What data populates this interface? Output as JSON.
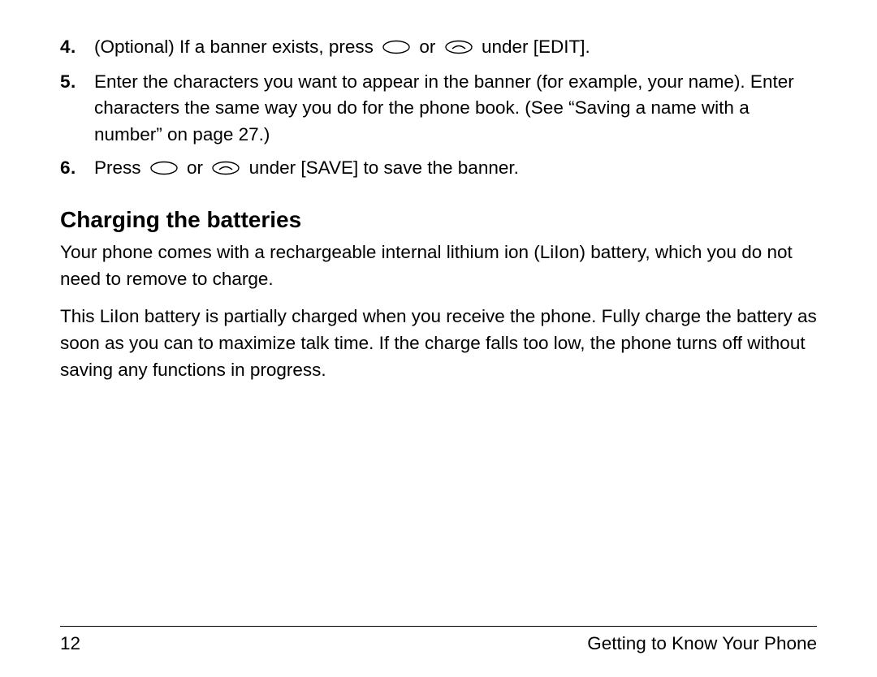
{
  "items": [
    {
      "num": "4.",
      "parts": {
        "a": "(Optional) If a banner exists, press ",
        "or": " or ",
        "b": " under [EDIT]."
      }
    },
    {
      "num": "5.",
      "text": "Enter the characters you want to appear in the banner (for example, your name). Enter characters the same way you do for the phone book. (See “Saving a name with a number” on page 27.)"
    },
    {
      "num": "6.",
      "parts": {
        "a": "Press ",
        "or": " or ",
        "b": " under [SAVE] to save the banner."
      }
    }
  ],
  "heading": "Charging the batteries",
  "p1": "Your phone comes with a rechargeable internal lithium ion (LiIon) battery, which you do not need to remove to charge.",
  "p2": "This LiIon battery is partially charged when you receive the phone. Fully charge the battery as soon as you can to maximize talk time. If the charge falls too low, the phone turns off without saving any functions in progress.",
  "footer": {
    "page": "12",
    "section": "Getting to Know Your Phone"
  }
}
